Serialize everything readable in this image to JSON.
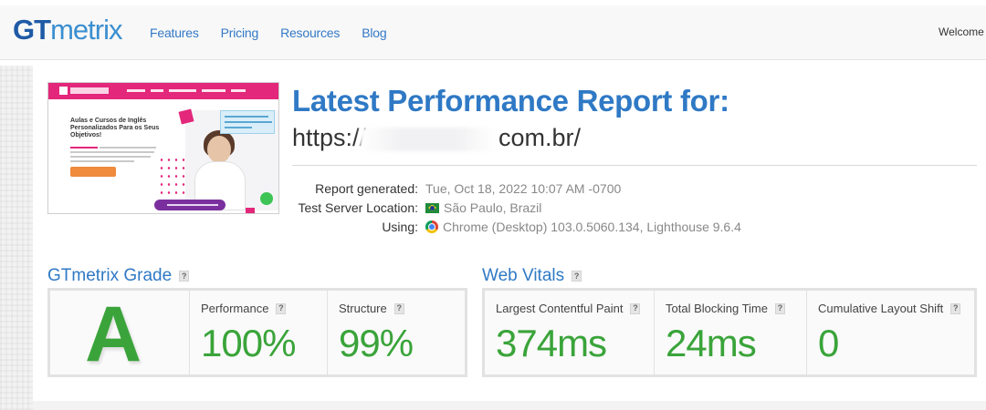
{
  "header": {
    "logo_gt": "GT",
    "logo_metrix": "metrix",
    "nav": [
      "Features",
      "Pricing",
      "Resources",
      "Blog"
    ],
    "welcome_text": "Welcome B"
  },
  "thumbnail": {
    "headline": "Aulas e Cursos de Inglês Personalizados Para os Seus Objetivos!"
  },
  "report": {
    "title": "Latest Performance Report for:",
    "url_prefix": "https://",
    "url_suffix": "com.br/",
    "meta": [
      {
        "label": "Report generated:",
        "value": "Tue, Oct 18, 2022 10:07 AM -0700",
        "icon": ""
      },
      {
        "label": "Test Server Location:",
        "value": "São Paulo, Brazil",
        "icon": "brazil-flag-icon"
      },
      {
        "label": "Using:",
        "value": "Chrome (Desktop) 103.0.5060.134, Lighthouse 9.6.4",
        "icon": "chrome-icon"
      }
    ]
  },
  "grade": {
    "section_title": "GTmetrix Grade",
    "letter": "A",
    "performance_label": "Performance",
    "performance_value": "100%",
    "structure_label": "Structure",
    "structure_value": "99%"
  },
  "vitals": {
    "section_title": "Web Vitals",
    "items": [
      {
        "label": "Largest Contentful Paint",
        "value": "374ms"
      },
      {
        "label": "Total Blocking Time",
        "value": "24ms"
      },
      {
        "label": "Cumulative Layout Shift",
        "value": "0"
      }
    ]
  },
  "help_glyph": "?",
  "colors": {
    "brand_blue": "#2f79c5",
    "grade_green": "#3aa43a"
  }
}
